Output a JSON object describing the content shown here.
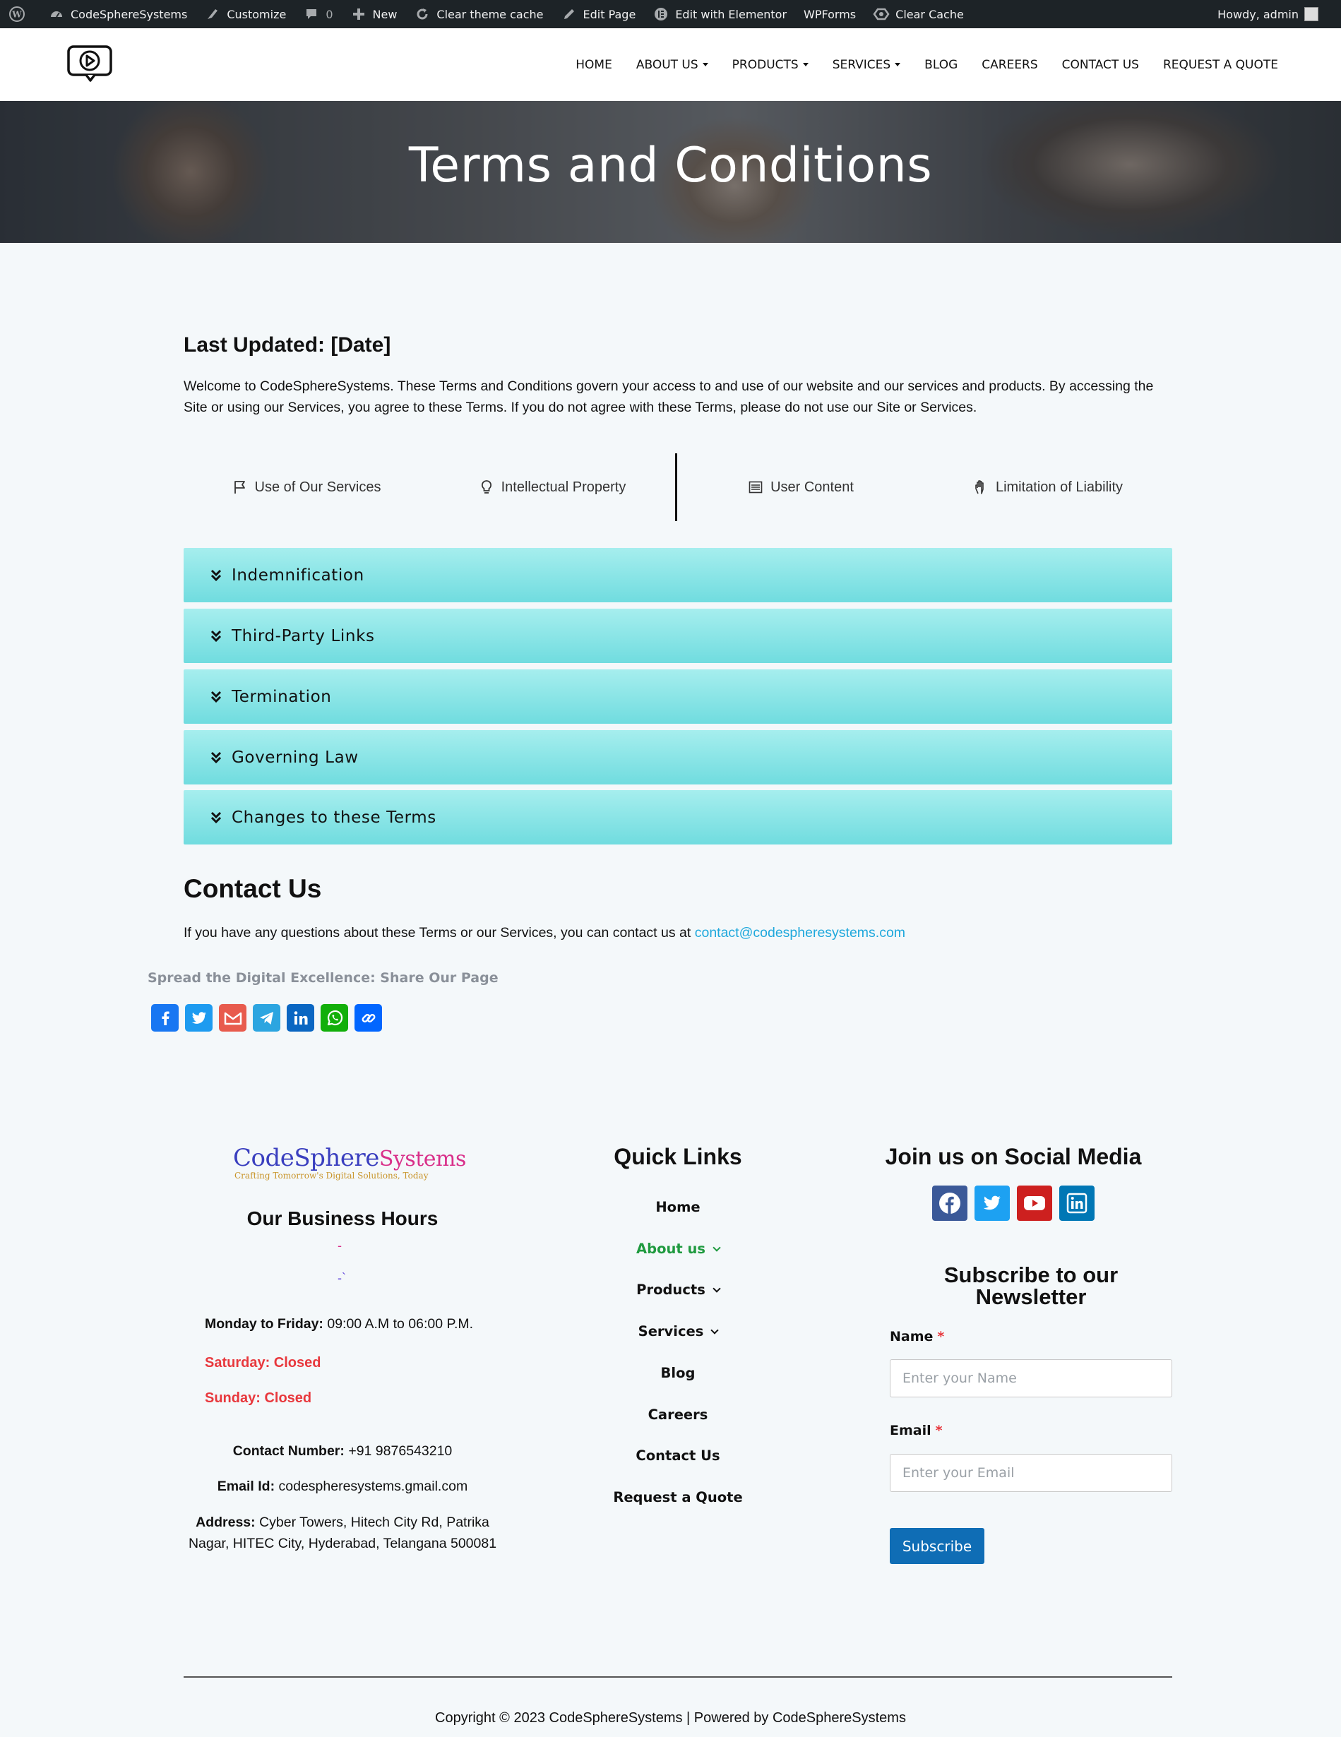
{
  "admin_bar": {
    "site_name": "CodeSphereSystems",
    "customize": "Customize",
    "comments_count": "0",
    "new": "New",
    "clear_theme_cache": "Clear theme cache",
    "edit_page": "Edit Page",
    "edit_elementor": "Edit with Elementor",
    "wpforms": "WPForms",
    "clear_cache": "Clear Cache",
    "howdy": "Howdy, admin"
  },
  "nav": {
    "home": "HOME",
    "about": "ABOUT US",
    "products": "PRODUCTS",
    "services": "SERVICES",
    "blog": "BLOG",
    "careers": "CAREERS",
    "contact": "CONTACT US",
    "quote": "REQUEST A QUOTE"
  },
  "hero": {
    "title": "Terms and Conditions"
  },
  "content": {
    "last_updated": "Last Updated: [Date]",
    "intro": "Welcome to CodeSphereSystems. These Terms and Conditions govern your access to and use of our website and our services and products. By accessing the Site or using our Services, you agree to these Terms. If you do not agree with these Terms, please do not use our Site or Services.",
    "tabs": [
      "Use of Our Services",
      "Intellectual Property",
      "User Content",
      "Limitation of Liability"
    ],
    "accordion": [
      "Indemnification",
      "Third-Party Links",
      "Termination",
      "Governing Law",
      "Changes to these Terms"
    ],
    "contact_heading": "Contact Us",
    "contact_text": "If you have any questions about these Terms or our Services, you can contact us at ",
    "contact_email": "contact@codespheresystems.com",
    "share_title": "Spread the Digital Excellence: Share Our Page"
  },
  "colors": {
    "accordion": "#70dcdf",
    "link": "#1fa8dc",
    "closed": "#e8383d",
    "active_link": "#1f9a3f",
    "subscribe": "#0f6db5"
  },
  "footer": {
    "logo_main": "CodeSphere",
    "logo_accent": "Systems",
    "logo_tagline": "Crafting Tomorrow's Digital Solutions, Today",
    "hours_title": "Our Business Hours",
    "dash1": "-",
    "dash2": "-`",
    "weekday_label": "Monday to Friday:",
    "weekday_hours": "09:00 A.M to 06:00 P.M.",
    "saturday": "Saturday: Closed",
    "sunday": "Sunday: Closed",
    "phone_label": "Contact Number:",
    "phone": "+91 9876543210",
    "email_label": "Email Id:",
    "email": "codespheresystems.gmail.com",
    "address_label": "Address:",
    "address_line1": "Cyber Towers, Hitech City Rd, Patrika",
    "address_line2": "Nagar, HITEC City, Hyderabad, Telangana 500081",
    "quick_links_title": "Quick Links",
    "quick_links": [
      "Home",
      "About us",
      "Products",
      "Services",
      "Blog",
      "Careers",
      "Contact Us",
      "Request a Quote"
    ],
    "social_title": "Join us on Social Media",
    "newsletter_title_1": "Subscribe to our",
    "newsletter_title_2": "Newsletter",
    "name_label": "Name",
    "name_placeholder": "Enter your Name",
    "email_field_label": "Email",
    "email_placeholder": "Enter your Email",
    "required_mark": "*",
    "subscribe": "Subscribe",
    "copyright": "Copyright © 2023 CodeSphereSystems | Powered by CodeSphereSystems"
  }
}
